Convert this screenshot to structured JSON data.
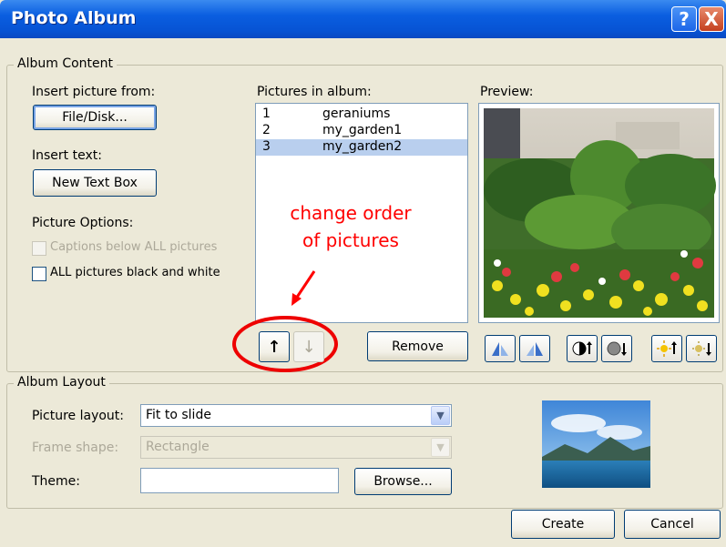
{
  "window": {
    "title": "Photo Album",
    "help_glyph": "?",
    "close_glyph": "X"
  },
  "album_content": {
    "legend": "Album Content",
    "insert_picture_label": "Insert picture from:",
    "file_disk_button": "File/Disk...",
    "insert_text_label": "Insert text:",
    "new_text_box_button": "New Text Box",
    "picture_options_label": "Picture Options:",
    "captions_option": {
      "label": "Captions below ALL pictures",
      "checked": false,
      "enabled": false
    },
    "black_white_option": {
      "label": "ALL pictures black and white",
      "checked": false,
      "enabled": true
    },
    "pictures_label": "Pictures in album:",
    "pictures": [
      {
        "num": "1",
        "name": "geraniums",
        "selected": false
      },
      {
        "num": "2",
        "name": "my_garden1",
        "selected": false
      },
      {
        "num": "3",
        "name": "my_garden2",
        "selected": true
      }
    ],
    "move_up_glyph": "↑",
    "move_down_glyph": "↓",
    "remove_button": "Remove",
    "preview_label": "Preview:",
    "preview_tools": [
      "rotate-left-icon",
      "rotate-right-icon",
      "contrast-up-icon",
      "contrast-down-icon",
      "brightness-up-icon",
      "brightness-down-icon"
    ]
  },
  "annotation": {
    "line1": "change order",
    "line2": "of pictures",
    "color": "#ff0000"
  },
  "album_layout": {
    "legend": "Album Layout",
    "picture_layout_label": "Picture layout:",
    "picture_layout_value": "Fit to slide",
    "frame_shape_label": "Frame shape:",
    "frame_shape_value": "Rectangle",
    "theme_label": "Theme:",
    "theme_value": "",
    "browse_button": "Browse..."
  },
  "footer": {
    "create_button": "Create",
    "cancel_button": "Cancel"
  }
}
